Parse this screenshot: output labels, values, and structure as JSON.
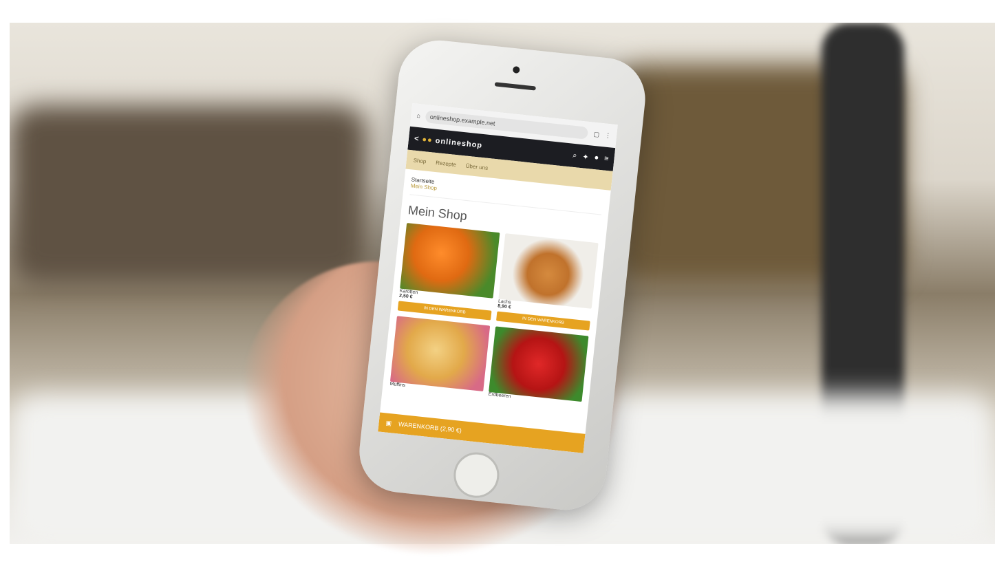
{
  "browser": {
    "url": "onlineshop.example.net"
  },
  "app": {
    "brand_prefix": "<",
    "brand": "onlineshop"
  },
  "nav": {
    "items": [
      "Shop",
      "Rezepte",
      "Über uns"
    ]
  },
  "breadcrumbs": {
    "main": "Startseite",
    "sub": "Mein Shop"
  },
  "page": {
    "title": "Mein Shop"
  },
  "products": [
    {
      "name": "Karotten",
      "price": "2,50 €",
      "button": "IN DEN WARENKORB"
    },
    {
      "name": "Lachs",
      "price": "8,90 €",
      "button": "IN DEN WARENKORB"
    },
    {
      "name": "Muffins",
      "price": "",
      "button": ""
    },
    {
      "name": "Erdbeeren",
      "price": "",
      "button": ""
    }
  ],
  "cart": {
    "label": "WARENKORB (2,90 €)"
  }
}
